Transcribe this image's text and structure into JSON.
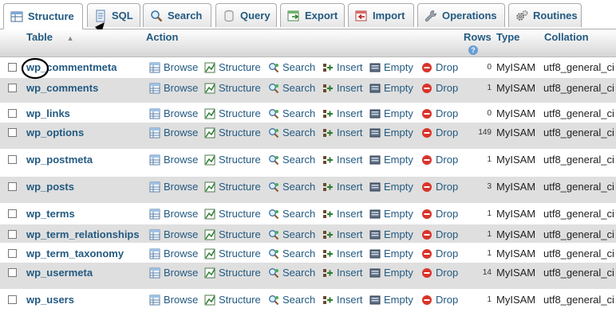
{
  "tabs": [
    {
      "label": "Structure",
      "icon": "structure-icon"
    },
    {
      "label": "SQL",
      "icon": "sql-icon"
    },
    {
      "label": "Search",
      "icon": "search-icon"
    },
    {
      "label": "Query",
      "icon": "query-icon"
    },
    {
      "label": "Export",
      "icon": "export-icon"
    },
    {
      "label": "Import",
      "icon": "import-icon"
    },
    {
      "label": "Operations",
      "icon": "wrench-icon"
    },
    {
      "label": "Routines",
      "icon": "gears-icon"
    }
  ],
  "columns": {
    "table": "Table",
    "action": "Action",
    "rows": "Rows",
    "type": "Type",
    "collation": "Collation"
  },
  "actions": {
    "browse": "Browse",
    "structure": "Structure",
    "search": "Search",
    "insert": "Insert",
    "empty": "Empty",
    "drop": "Drop"
  },
  "tables": [
    {
      "name": "wp_commentmeta",
      "rows": "0",
      "type": "MyISAM",
      "collation": "utf8_general_ci"
    },
    {
      "name": "wp_comments",
      "rows": "1",
      "type": "MyISAM",
      "collation": "utf8_general_ci"
    },
    {
      "name": "wp_links",
      "rows": "0",
      "type": "MyISAM",
      "collation": "utf8_general_ci"
    },
    {
      "name": "wp_options",
      "rows": "149",
      "type": "MyISAM",
      "collation": "utf8_general_ci"
    },
    {
      "name": "wp_postmeta",
      "rows": "1",
      "type": "MyISAM",
      "collation": "utf8_general_ci"
    },
    {
      "name": "wp_posts",
      "rows": "3",
      "type": "MyISAM",
      "collation": "utf8_general_ci"
    },
    {
      "name": "wp_terms",
      "rows": "1",
      "type": "MyISAM",
      "collation": "utf8_general_ci"
    },
    {
      "name": "wp_term_relationships",
      "rows": "1",
      "type": "MyISAM",
      "collation": "utf8_general_ci"
    },
    {
      "name": "wp_term_taxonomy",
      "rows": "1",
      "type": "MyISAM",
      "collation": "utf8_general_ci"
    },
    {
      "name": "wp_usermeta",
      "rows": "14",
      "type": "MyISAM",
      "collation": "utf8_general_ci"
    },
    {
      "name": "wp_users",
      "rows": "1",
      "type": "MyISAM",
      "collation": "utf8_general_ci"
    }
  ],
  "colors": {
    "link": "#235a81",
    "row_alt": "#dfdfdf",
    "drop_red": "#d9342b"
  }
}
